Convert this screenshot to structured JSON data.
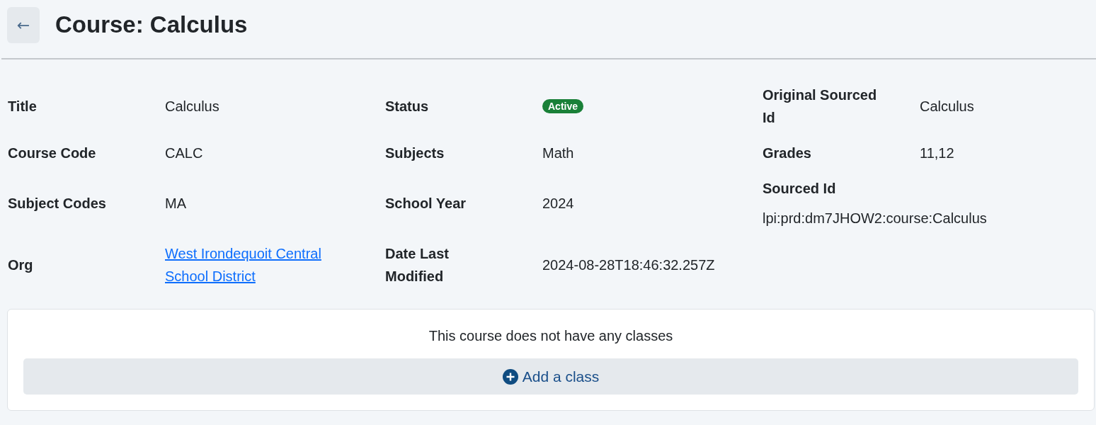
{
  "header": {
    "back_button": "←",
    "title": "Course: Calculus"
  },
  "fields": [
    {
      "label": "Title",
      "value": "Calculus",
      "kind": "text",
      "stacked": false
    },
    {
      "label": "Status",
      "value": "Active",
      "kind": "badge",
      "stacked": false,
      "color": "#198038"
    },
    {
      "label": "Original Sourced Id",
      "value": "Calculus",
      "kind": "text",
      "stacked": false
    },
    {
      "label": "Course Code",
      "value": "CALC",
      "kind": "text",
      "stacked": false
    },
    {
      "label": "Subjects",
      "value": "Math",
      "kind": "text",
      "stacked": false
    },
    {
      "label": "Grades",
      "value": "11,12",
      "kind": "text",
      "stacked": false
    },
    {
      "label": "Subject Codes",
      "value": "MA",
      "kind": "text",
      "stacked": false
    },
    {
      "label": "School Year",
      "value": "2024",
      "kind": "text",
      "stacked": false
    },
    {
      "label": "Sourced Id",
      "value": "lpi:prd:dm7JHOW2:course:Calculus",
      "kind": "text",
      "stacked": true
    },
    {
      "label": "Org",
      "value": "West Irondequoit Central School District",
      "kind": "link",
      "stacked": false
    },
    {
      "label": "Date Last Modified",
      "value": "2024-08-28T18:46:32.257Z",
      "kind": "text",
      "stacked": false
    }
  ],
  "classes": {
    "empty_message": "This course does not have any classes",
    "add_button": "Add a class"
  }
}
